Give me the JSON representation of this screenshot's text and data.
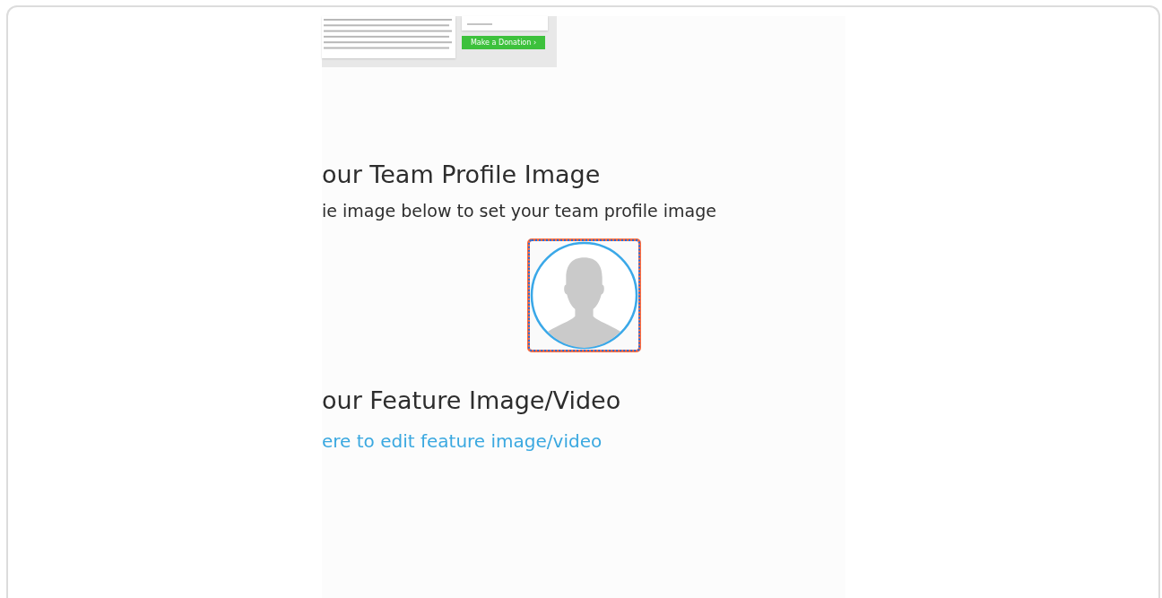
{
  "preview": {
    "donate_button": "Make a Donation ›"
  },
  "team_profile": {
    "heading": "our Team Profile Image",
    "instruction": "ie image below to set your team profile image",
    "avatar_selected": true
  },
  "feature": {
    "heading": "our Feature Image/Video",
    "link": "ere to edit feature image/video"
  }
}
